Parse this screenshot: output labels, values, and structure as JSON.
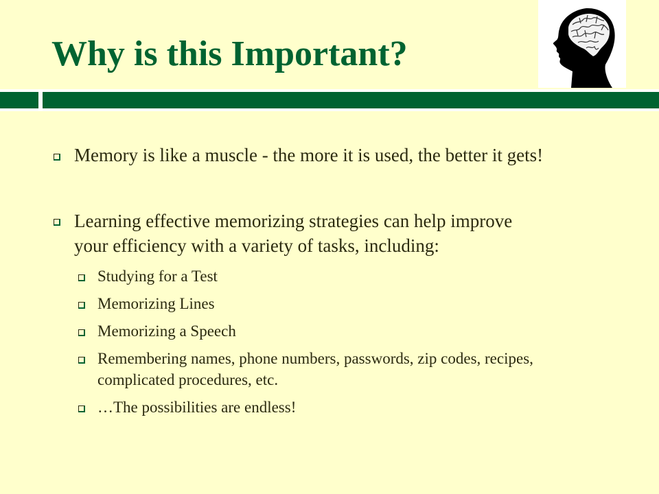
{
  "slide": {
    "title": "Why is this Important?",
    "image": "brain-head-silhouette-icon",
    "bullets": [
      {
        "text": "Memory is like a muscle - the more it is used, the better it gets!"
      },
      {
        "line1": "Learning effective memorizing strategies can help improve",
        "line2": "your efficiency with a variety of tasks, including:",
        "subitems": [
          {
            "text": "Studying for a Test"
          },
          {
            "text": "Memorizing Lines"
          },
          {
            "text": "Memorizing a Speech"
          },
          {
            "line1": "Remembering names, phone numbers, passwords, zip codes, recipes,",
            "line2": "complicated procedures, etc."
          },
          {
            "text": "…The possibilities are endless!"
          }
        ]
      }
    ]
  },
  "colors": {
    "background": "#FFFFCC",
    "accent": "#006331",
    "text": "#2B2A10"
  }
}
